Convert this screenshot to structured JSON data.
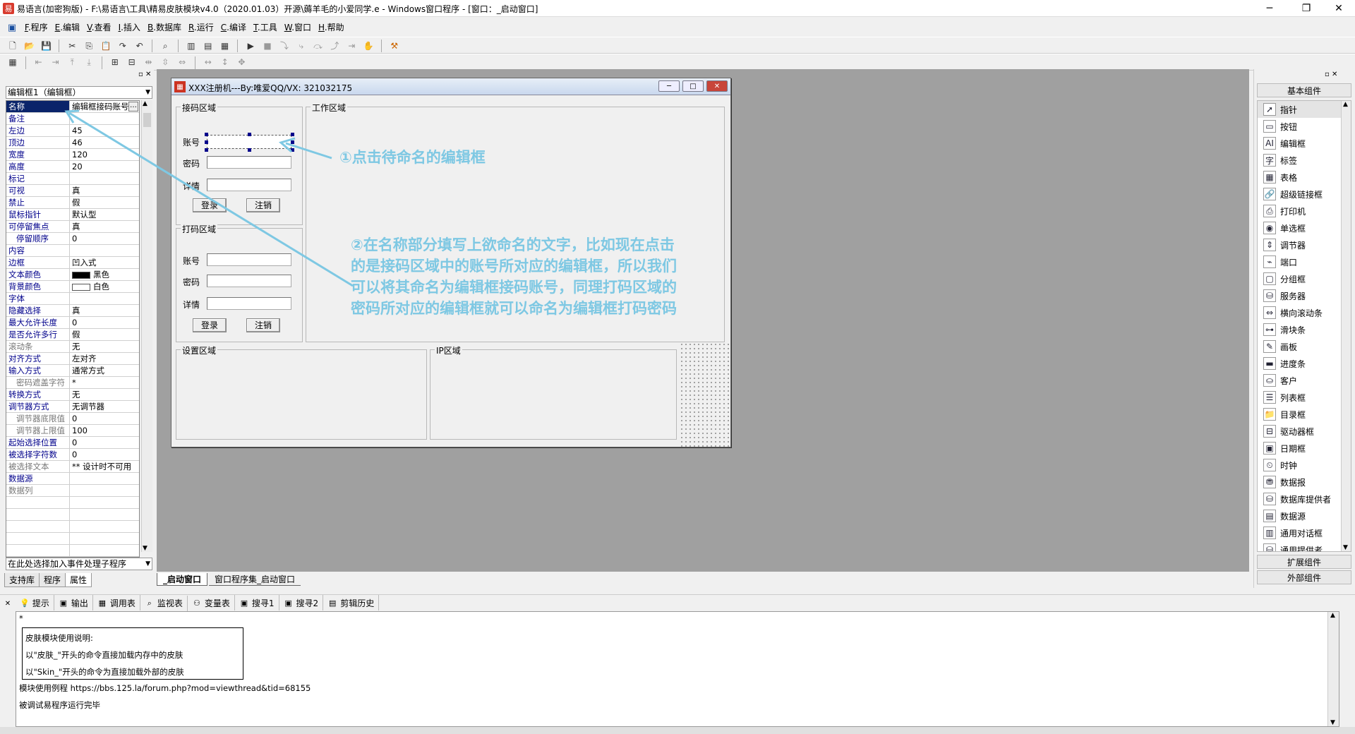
{
  "titlebar": {
    "title": "易语言(加密狗版) - F:\\易语言\\工具\\精易皮肤模块v4.0（2020.01.03）开源\\薅羊毛的小爱同学.e - Windows窗口程序 - [窗口：_启动窗口]",
    "minimize": "─",
    "maximize": "❐",
    "close": "✕"
  },
  "menubar": {
    "items": [
      {
        "key": "F",
        "label": ".程序"
      },
      {
        "key": "E",
        "label": ".编辑"
      },
      {
        "key": "V",
        "label": ".查看"
      },
      {
        "key": "I",
        "label": ".插入"
      },
      {
        "key": "B",
        "label": ".数据库"
      },
      {
        "key": "R",
        "label": ".运行"
      },
      {
        "key": "C",
        "label": ".编译"
      },
      {
        "key": "T",
        "label": ".工具"
      },
      {
        "key": "W",
        "label": ".窗口"
      },
      {
        "key": "H",
        "label": ".帮助"
      }
    ]
  },
  "properties": {
    "selector": "编辑框1（编辑框）",
    "rows": [
      {
        "k": "名称",
        "v": "编辑框接码账号",
        "sel": true
      },
      {
        "k": "备注",
        "v": ""
      },
      {
        "k": "左边",
        "v": "45"
      },
      {
        "k": "顶边",
        "v": "46"
      },
      {
        "k": "宽度",
        "v": "120"
      },
      {
        "k": "高度",
        "v": "20"
      },
      {
        "k": "标记",
        "v": ""
      },
      {
        "k": "可视",
        "v": "真"
      },
      {
        "k": "禁止",
        "v": "假"
      },
      {
        "k": "鼠标指针",
        "v": "默认型"
      },
      {
        "k": "可停留焦点",
        "v": "真"
      },
      {
        "k": "停留顺序",
        "v": "0",
        "sub": true
      },
      {
        "k": "内容",
        "v": ""
      },
      {
        "k": "边框",
        "v": "凹入式"
      },
      {
        "k": "文本颜色",
        "v": "黑色"
      },
      {
        "k": "背景颜色",
        "v": "白色"
      },
      {
        "k": "字体",
        "v": ""
      },
      {
        "k": "隐藏选择",
        "v": "真"
      },
      {
        "k": "最大允许长度",
        "v": "0"
      },
      {
        "k": "是否允许多行",
        "v": "假"
      },
      {
        "k": "滚动条",
        "v": "无",
        "gray": true
      },
      {
        "k": "对齐方式",
        "v": "左对齐"
      },
      {
        "k": "输入方式",
        "v": "通常方式"
      },
      {
        "k": "密码遮盖字符",
        "v": "*",
        "sub": true,
        "gray": true
      },
      {
        "k": "转换方式",
        "v": "无"
      },
      {
        "k": "调节器方式",
        "v": "无调节器"
      },
      {
        "k": "调节器底限值",
        "v": "0",
        "sub": true,
        "gray": true
      },
      {
        "k": "调节器上限值",
        "v": "100",
        "sub": true,
        "gray": true
      },
      {
        "k": "起始选择位置",
        "v": "0"
      },
      {
        "k": "被选择字符数",
        "v": "0"
      },
      {
        "k": "被选择文本",
        "v": "** 设计时不可用",
        "gray": true
      },
      {
        "k": "数据源",
        "v": ""
      },
      {
        "k": "数据列",
        "v": "",
        "gray": true
      }
    ],
    "event_selector": "在此处选择加入事件处理子程序",
    "tabs": [
      "支持库",
      "程序",
      "属性"
    ]
  },
  "form": {
    "title": "XXX注册机---By:唯爱QQ/VX:  321032175",
    "groups": {
      "receive": "接码区域",
      "work": "工作区域",
      "print": "打码区域",
      "settings": "设置区域",
      "ip": "IP区域"
    },
    "labels": {
      "account": "账号",
      "password": "密码",
      "detail": "详情"
    },
    "buttons": {
      "login": "登录",
      "logout": "注销"
    }
  },
  "annotations": {
    "step1": "①点击待命名的编辑框",
    "step2_lines": [
      "②在名称部分填写上欲命名的文字，比如现在点击",
      "的是接码区域中的账号所对应的编辑框，所以我们",
      "可以将其命名为编辑框接码账号，同理打码区域的",
      "密码所对应的编辑框就可以命名为编辑框打码密码"
    ],
    "color": "#7ec8e3"
  },
  "editor_tabs": [
    "_启动窗口",
    "窗口程序集_启动窗口"
  ],
  "components": {
    "header": "基本组件",
    "items": [
      "指针",
      "按钮",
      "编辑框",
      "标签",
      "表格",
      "超级链接框",
      "打印机",
      "单选框",
      "调节器",
      "端口",
      "分组框",
      "服务器",
      "横向滚动条",
      "滑块条",
      "画板",
      "进度条",
      "客户",
      "列表框",
      "目录框",
      "驱动器框",
      "日期框",
      "时钟",
      "数据报",
      "数据库提供者",
      "数据源",
      "通用对话框",
      "通用提供者"
    ],
    "footer1": "扩展组件",
    "footer2": "外部组件"
  },
  "output_tabs": [
    "提示",
    "输出",
    "调用表",
    "监视表",
    "变量表",
    "搜寻1",
    "搜寻2",
    "剪辑历史"
  ],
  "output": {
    "star": "*",
    "box_title": "皮肤模块使用说明:",
    "box_line1": "以\"皮肤_\"开头的命令直接加载内存中的皮肤",
    "box_line2": "以\"Skin_\"开头的命令为直接加载外部的皮肤",
    "example": "模块使用例程 https://bbs.125.la/forum.php?mod=viewthread&tid=68155",
    "done": "被调试易程序运行完毕"
  }
}
